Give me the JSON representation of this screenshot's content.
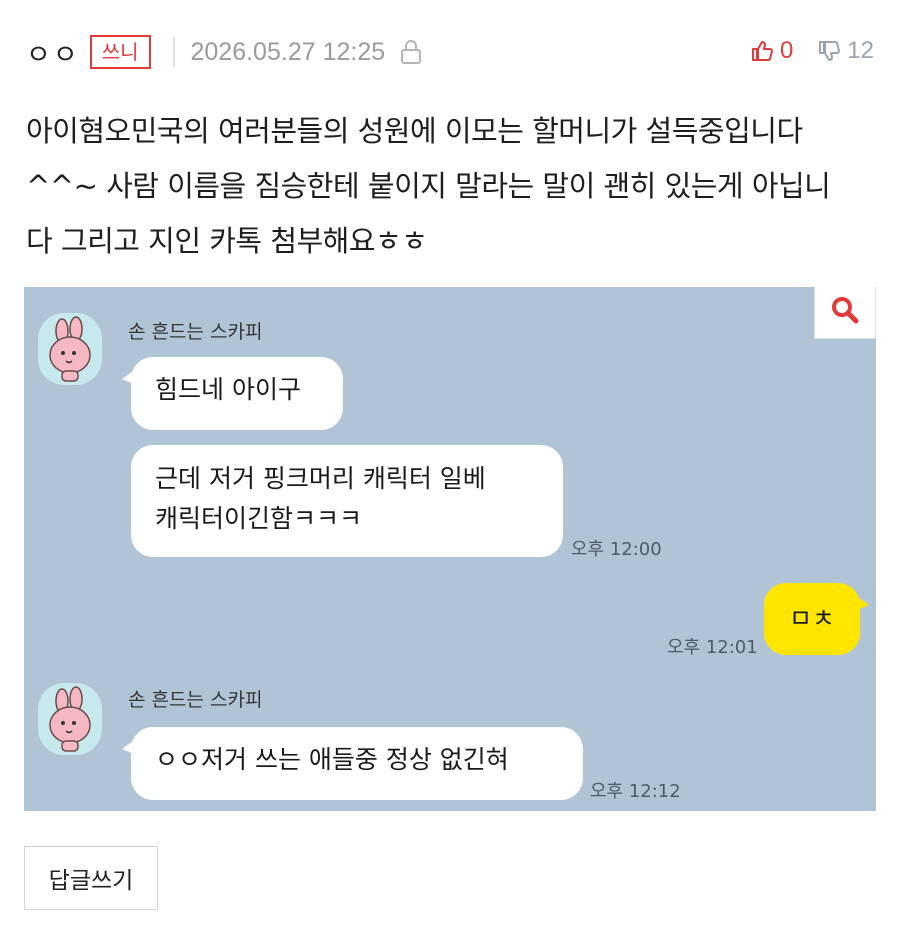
{
  "header": {
    "author": "ㅇㅇ",
    "author_badge": "쓰니",
    "date": "2026.05.27 12:25",
    "upvotes": "0",
    "downvotes": "12"
  },
  "post": {
    "lines": [
      "아이혐오민국의 여러분들의 성원에 이모는 할머니가 설득중입니다",
      "^^~ 사람 이름을 짐승한테 붙이지 말라는 말이 괜히 있는게 아닙니",
      "다 그리고 지인 카톡 첨부해요ㅎㅎ"
    ]
  },
  "chat": {
    "sender_1": "손 흔드는 스카피",
    "msg_1": "힘드네 아이구",
    "msg_2_line1": "근데 저거 핑크머리 캐릭터 일베",
    "msg_2_line2": "캐릭터이긴함ㅋㅋㅋ",
    "time_1": "오후 12:00",
    "my_msg": "ㅁㅊ",
    "time_2": "오후 12:01",
    "sender_2": "손 흔드는 스카피",
    "msg_3": "ㅇㅇ저거 쓰는 애들중 정상 없긴혀",
    "time_3": "오후 12:12"
  },
  "actions": {
    "reply_label": "답글쓰기"
  },
  "colors": {
    "accent_red": "#e03a3a",
    "chat_bg": "#b1c4d6",
    "my_bubble": "#fee500"
  },
  "icons": [
    "lock-icon",
    "thumbs-up-icon",
    "thumbs-down-icon",
    "zoom-icon"
  ]
}
